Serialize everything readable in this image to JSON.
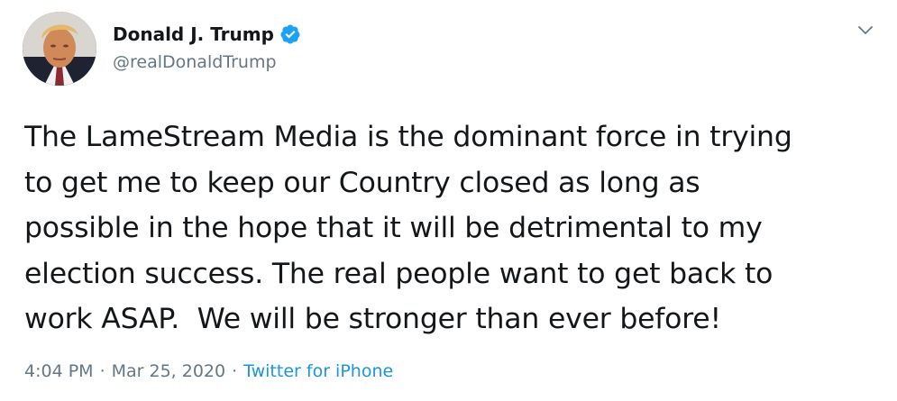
{
  "author": {
    "display_name": "Donald J. Trump",
    "handle": "@realDonaldTrump",
    "verified": true,
    "avatar_icon": "profile-photo"
  },
  "tweet": {
    "text": "The LameStream Media is the dominant force in trying\nto get me to keep our Country closed as long as\npossible in the hope that it will be detrimental to my\nelection success. The real people want to get back to\nwork ASAP.  We will be stronger than ever before!"
  },
  "meta": {
    "time": "4:04 PM",
    "separator": "·",
    "date": "Mar 25, 2020",
    "source": "Twitter for iPhone"
  },
  "icons": {
    "verified_badge": "verified-badge-icon",
    "more_menu": "chevron-down-icon"
  },
  "colors": {
    "verified_blue": "#1da1f2",
    "link_blue": "#1b95e0",
    "secondary_text": "#657786",
    "primary_text": "#14171a"
  }
}
